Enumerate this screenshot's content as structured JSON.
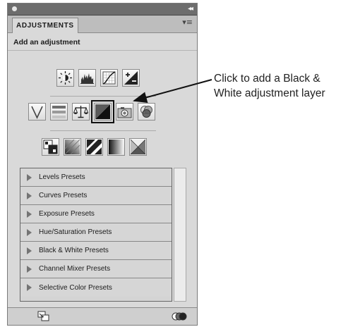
{
  "panel": {
    "tab_label": "ADJUSTMENTS",
    "collapse_glyph": "◂◂",
    "menu_glyph": "▾≡",
    "subtitle": "Add an adjustment"
  },
  "icons": {
    "row1": [
      "brightness-contrast-icon",
      "levels-icon",
      "curves-icon",
      "exposure-icon"
    ],
    "row2": [
      "vibrance-icon",
      "hue-saturation-icon",
      "color-balance-icon",
      "black-white-icon",
      "photo-filter-icon",
      "channel-mixer-icon"
    ],
    "row3": [
      "invert-icon",
      "posterize-icon",
      "threshold-icon",
      "gradient-map-icon",
      "selective-color-icon"
    ]
  },
  "presets": [
    "Levels Presets",
    "Curves Presets",
    "Exposure Presets",
    "Hue/Saturation Presets",
    "Black & White Presets",
    "Channel Mixer Presets",
    "Selective Color Presets"
  ],
  "callout": {
    "line1": "Click to add a Black &",
    "line2": "White adjustment layer"
  }
}
